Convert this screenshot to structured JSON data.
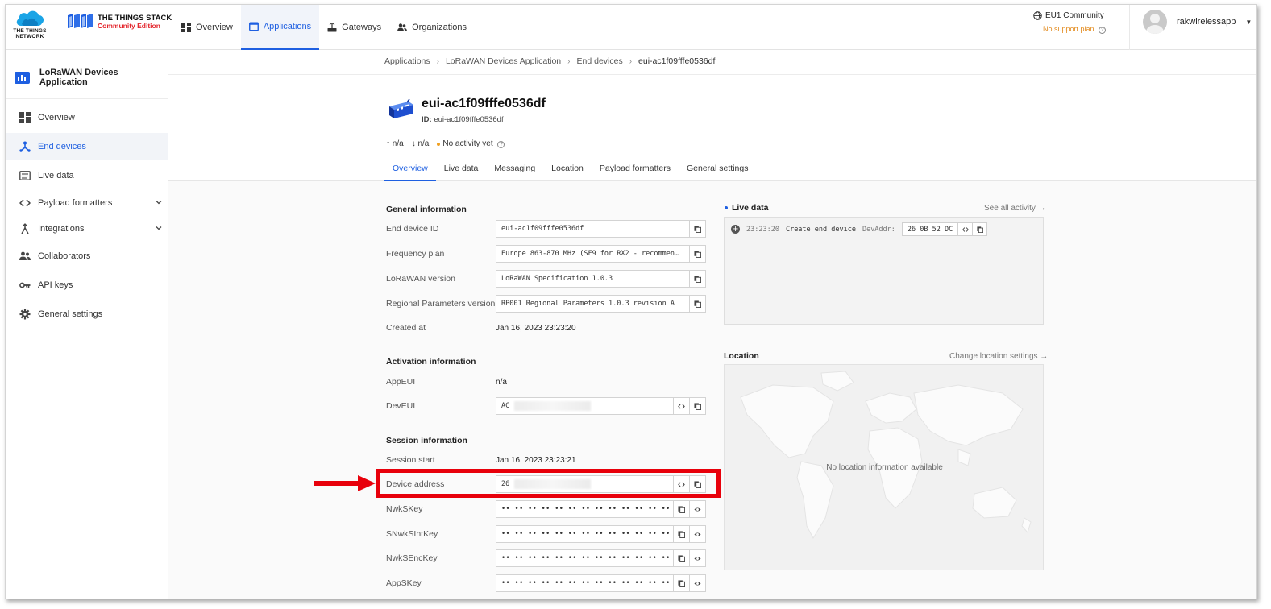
{
  "header": {
    "ttn_logo_text": "THE THINGS NETWORK",
    "tts_name": "THE THINGS STACK",
    "tts_edition": "Community Edition",
    "nav": [
      {
        "label": "Overview"
      },
      {
        "label": "Applications"
      },
      {
        "label": "Gateways"
      },
      {
        "label": "Organizations"
      }
    ],
    "cluster": "EU1 Community",
    "support": "No support plan",
    "username": "rakwirelessapp"
  },
  "sidebar": {
    "app_title": "LoRaWAN Devices Application",
    "items": [
      {
        "label": "Overview"
      },
      {
        "label": "End devices"
      },
      {
        "label": "Live data"
      },
      {
        "label": "Payload formatters"
      },
      {
        "label": "Integrations"
      },
      {
        "label": "Collaborators"
      },
      {
        "label": "API keys"
      },
      {
        "label": "General settings"
      }
    ]
  },
  "breadcrumb": [
    "Applications",
    "LoRaWAN Devices Application",
    "End devices",
    "eui-ac1f09fffe0536df"
  ],
  "device": {
    "name": "eui-ac1f09fffe0536df",
    "id_label": "ID:",
    "id_value": "eui-ac1f09fffe0536df",
    "uplink": "n/a",
    "downlink": "n/a",
    "activity": "No activity yet"
  },
  "tabs": [
    "Overview",
    "Live data",
    "Messaging",
    "Location",
    "Payload formatters",
    "General settings"
  ],
  "general": {
    "title": "General information",
    "end_device_id_label": "End device ID",
    "end_device_id": "eui-ac1f09fffe0536df",
    "frequency_plan_label": "Frequency plan",
    "frequency_plan": "Europe 863-870 MHz (SF9 for RX2 - recommen…",
    "lorawan_version_label": "LoRaWAN version",
    "lorawan_version": "LoRaWAN Specification 1.0.3",
    "regional_label": "Regional Parameters version",
    "regional": "RP001 Regional Parameters 1.0.3 revision A",
    "created_label": "Created at",
    "created": "Jan 16, 2023 23:23:20"
  },
  "activation": {
    "title": "Activation information",
    "appeui_label": "AppEUI",
    "appeui": "n/a",
    "deveui_label": "DevEUI",
    "deveui": "AC"
  },
  "session": {
    "title": "Session information",
    "start_label": "Session start",
    "start": "Jan 16, 2023 23:23:21",
    "devaddr_label": "Device address",
    "devaddr": "26",
    "nwkskey_label": "NwkSKey",
    "snwksintkey_label": "SNwkSIntKey",
    "nwksenckey_label": "NwkSEncKey",
    "appskey_label": "AppSKey",
    "masked": "•• •• •• •• •• •• •• •• •• •• •• •• •• •• •• ••"
  },
  "live": {
    "title": "Live data",
    "see_all": "See all activity →",
    "event_time": "23:23:20",
    "event_text": "Create end device",
    "event_key": "DevAddr:",
    "event_value": "26 0B 52 DC"
  },
  "location": {
    "title": "Location",
    "change": "Change location settings →",
    "empty": "No location information available"
  },
  "colors": {
    "accent": "#1e5fe1",
    "highlight": "#e8000b",
    "edition": "#e3242b",
    "support": "#e38b1e"
  }
}
